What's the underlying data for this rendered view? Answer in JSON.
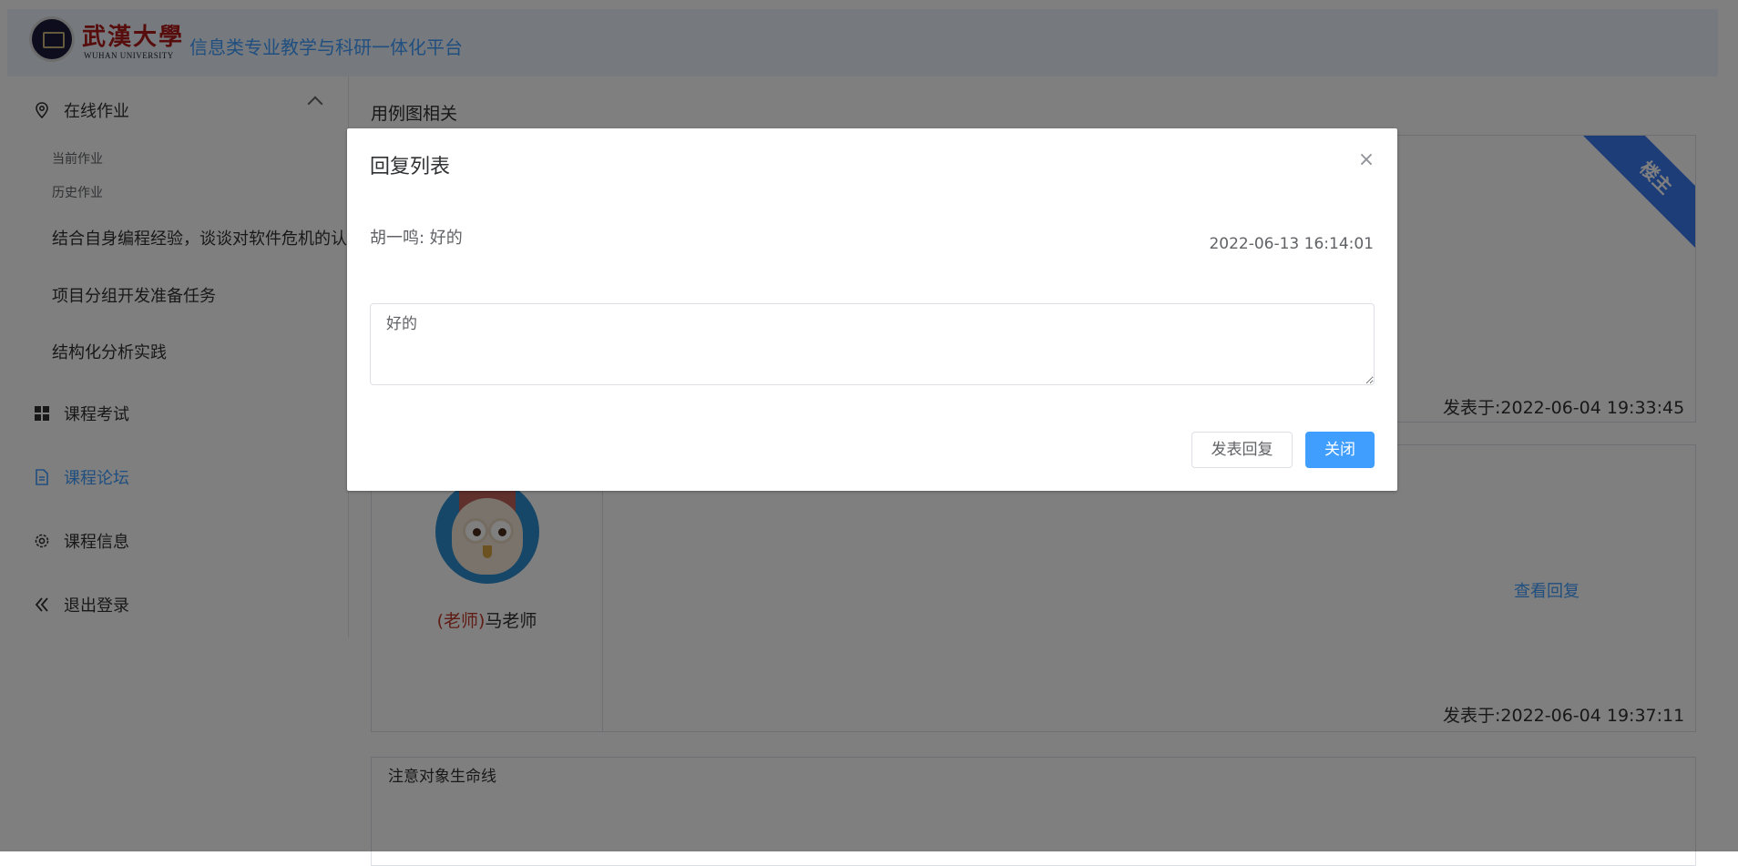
{
  "header": {
    "logo_cn": "武漢大學",
    "logo_en": "WUHAN UNIVERSITY",
    "platform_title": "信息类专业教学与科研一体化平台"
  },
  "sidebar": {
    "online_homework": "在线作业",
    "current_homework": "当前作业",
    "history_homework": "历史作业",
    "assignments": [
      "结合自身编程经验，谈谈对软件危机的认识",
      "项目分组开发准备任务",
      "结构化分析实践"
    ],
    "course_exam": "课程考试",
    "course_forum": "课程论坛",
    "course_info": "课程信息",
    "logout": "退出登录"
  },
  "main": {
    "section_title": "用例图相关",
    "post1": {
      "ribbon": "楼主",
      "posted_at": "发表于:2022-06-04 19:33:45"
    },
    "post2": {
      "teacher_role": "(老师)",
      "teacher_name": "马老师",
      "view_replies": "查看回复",
      "posted_at": "发表于:2022-06-04 19:37:11"
    },
    "post3": {
      "title": "注意对象生命线"
    }
  },
  "dialog": {
    "title": "回复列表",
    "close_glyph": "×",
    "reply": {
      "text": "胡一鸣: 好的",
      "time": "2022-06-13 16:14:01"
    },
    "input_value": "好的",
    "publish_button": "发表回复",
    "close_button": "关闭"
  },
  "colors": {
    "accent": "#409eff",
    "header_bg": "#ecf5ff",
    "ribbon": "#3a7bf0",
    "teacher_role": "#c0392b"
  }
}
